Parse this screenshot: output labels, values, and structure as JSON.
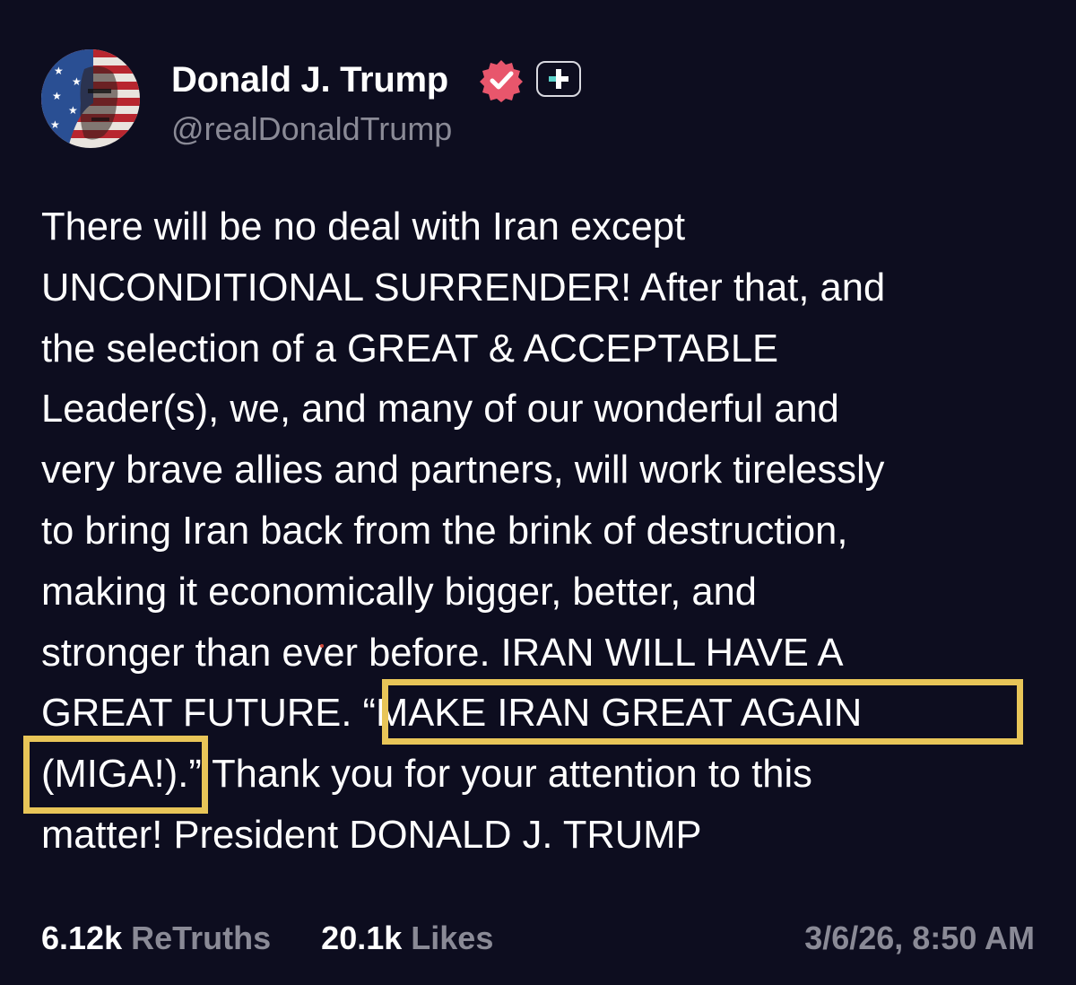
{
  "author": {
    "display_name": "Donald J. Trump",
    "handle": "@realDonaldTrump",
    "avatar_icon": "flag-portrait-avatar",
    "verified_icon": "verified-badge-icon",
    "plus_icon": "plus-badge-icon"
  },
  "post": {
    "lines": [
      "There will be no deal with Iran except",
      "UNCONDITIONAL SURRENDER! After that, and",
      "the selection of a GREAT & ACCEPTABLE",
      "Leader(s), we, and many of our wonderful and",
      "very brave allies and partners, will work tirelessly",
      "to bring Iran back from the brink of destruction,",
      "making it economically bigger, better, and",
      "stronger than ever before. IRAN WILL HAVE A",
      "GREAT FUTURE. “MAKE IRAN GREAT AGAIN",
      "(MIGA!).” Thank you for your attention to this",
      "matter! President DONALD J. TRUMP"
    ]
  },
  "stats": {
    "retruths_count": "6.12k",
    "retruths_label": "ReTruths",
    "likes_count": "20.1k",
    "likes_label": "Likes",
    "timestamp": "3/6/26, 8:50 AM"
  },
  "colors": {
    "background": "#0d0d1f",
    "verified": "#e8566c",
    "highlight": "#e8c558",
    "muted": "#8a8a96"
  }
}
